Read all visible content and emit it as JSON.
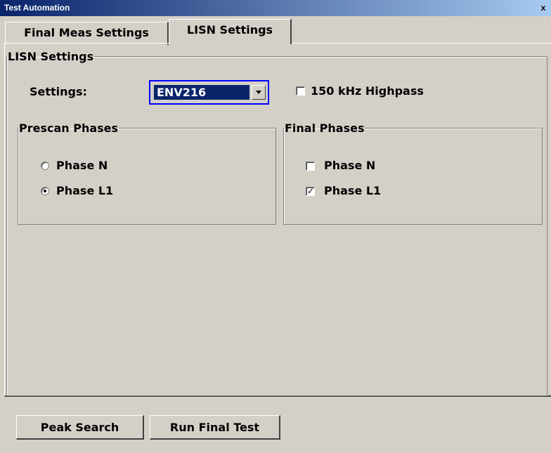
{
  "window": {
    "title": "Test Automation",
    "close_glyph": "x"
  },
  "tabs": [
    {
      "label": "Final Meas Settings",
      "active": false
    },
    {
      "label": "LISN Settings",
      "active": true
    }
  ],
  "lisn_group": {
    "legend": "LISN Settings",
    "settings_label": "Settings:",
    "settings_value": "ENV216",
    "highpass_label": "150 kHz Highpass",
    "highpass_checked": false
  },
  "prescan_phases": {
    "legend": "Prescan Phases",
    "options": [
      {
        "label": "Phase N",
        "selected": false
      },
      {
        "label": "Phase L1",
        "selected": true
      }
    ]
  },
  "final_phases": {
    "legend": "Final Phases",
    "options": [
      {
        "label": "Phase N",
        "checked": false
      },
      {
        "label": "Phase L1",
        "checked": true
      }
    ]
  },
  "buttons": {
    "peak_search": "Peak Search",
    "run_final_test": "Run Final Test"
  },
  "icons": {
    "close": "close-icon",
    "dropdown": "chevron-down-icon",
    "check_mark": "✓"
  },
  "colors": {
    "title_bar": "#0a246a",
    "background": "#d4d0c8",
    "focus_border": "#0000ff",
    "selection": "#0a246a"
  }
}
